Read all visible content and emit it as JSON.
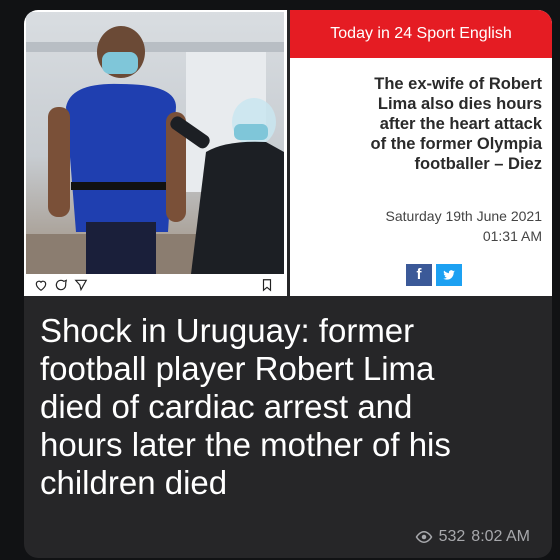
{
  "shared_post": {
    "image_alt": "Footballer receiving a vaccination",
    "actions": [
      "heart-outline-icon",
      "comment-icon",
      "send-icon",
      "bookmark-icon"
    ]
  },
  "news_card": {
    "brand": "Today in 24 Sport English",
    "headline_lines": [
      "The ex-wife of Robert",
      "Lima also dies hours",
      "after the heart attack",
      "of the former Olympia",
      "footballer – Diez"
    ],
    "date": "Saturday 19th June 2021",
    "time": "01:31 AM",
    "share": {
      "facebook": "f",
      "twitter": "twitter-icon"
    },
    "colors": {
      "header": "#e51c23",
      "facebook": "#3b5998",
      "twitter": "#1da1f2"
    }
  },
  "message": {
    "caption_lines": [
      "Shock in Uruguay: former",
      "football player Robert Lima",
      "died of cardiac arrest and",
      "hours later the mother of his",
      "children died"
    ],
    "views": "532",
    "time": "8:02 AM"
  }
}
